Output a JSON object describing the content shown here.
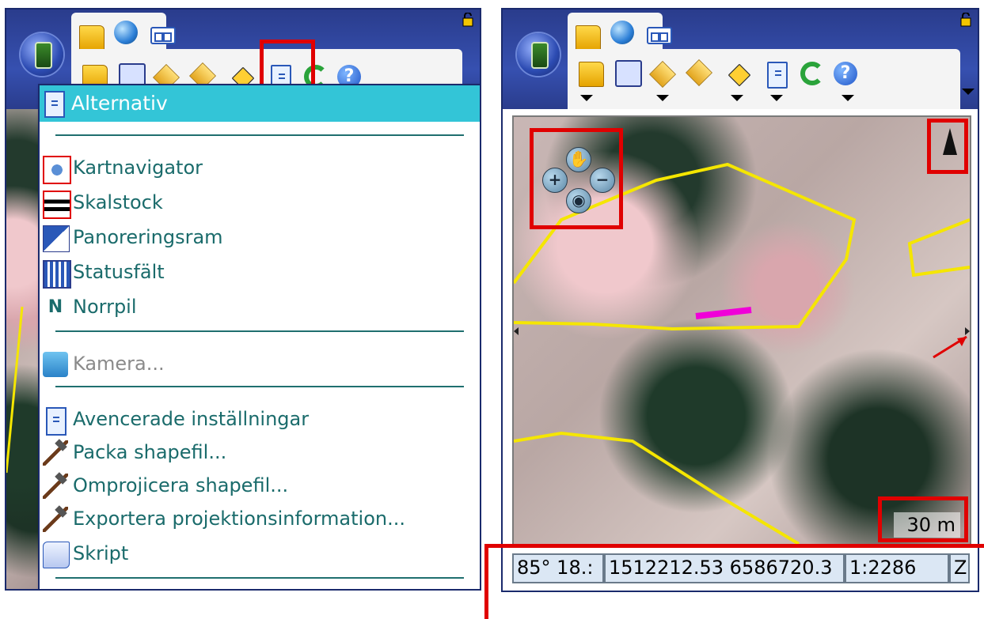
{
  "left_panel": {
    "menu": {
      "header_label": "Alternativ",
      "items": [
        {
          "label": "Kartnavigator",
          "icon": "map-navigator-icon"
        },
        {
          "label": "Skalstock",
          "icon": "scale-bar-icon"
        },
        {
          "label": "Panoreringsram",
          "icon": "pan-frame-icon"
        },
        {
          "label": "Statusfält",
          "icon": "status-bar-icon"
        },
        {
          "label": "Norrpil",
          "icon": "north-arrow-icon"
        },
        {
          "label": "Kamera...",
          "icon": "camera-icon",
          "disabled": true
        },
        {
          "label": "Avencerade inställningar",
          "icon": "document-icon"
        },
        {
          "label": "Packa shapefil...",
          "icon": "hammer-icon"
        },
        {
          "label": "Omprojicera shapefil...",
          "icon": "hammer-icon"
        },
        {
          "label": "Exportera projektionsinformation...",
          "icon": "hammer-icon"
        },
        {
          "label": "Skript",
          "icon": "script-icon"
        }
      ]
    }
  },
  "right_panel": {
    "map": {
      "scale_label": "30 m"
    },
    "statusbar": {
      "coordinate_dms": "85° 18.:",
      "coordinate_xy": "1512212.53 6586720.3",
      "scale": "1:2286",
      "extra": "Z"
    }
  },
  "colors": {
    "title_bar": "#2a3c8c",
    "menu_header": "#33c5d7",
    "menu_text": "#1a6b6b",
    "highlight_red": "#e00000",
    "polygon_yellow": "#f5e600",
    "track_magenta": "#f000d8"
  }
}
